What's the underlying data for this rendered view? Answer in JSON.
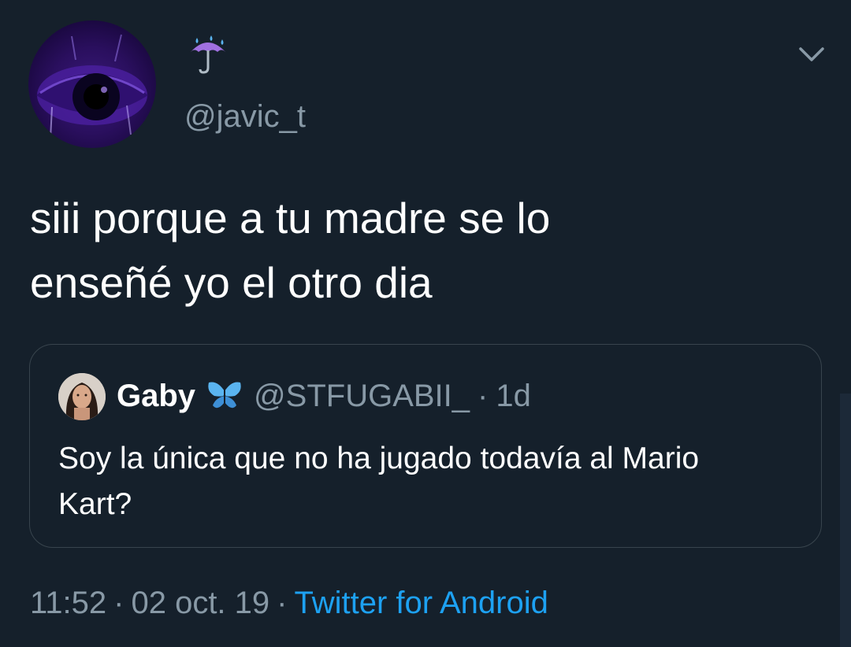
{
  "tweet": {
    "author": {
      "display_name_icon": "umbrella-with-rain-icon",
      "handle": "@javic_t"
    },
    "text_line_1": "siii porque a tu madre se lo",
    "text_line_2": "enseñé yo el otro dia",
    "quoted": {
      "display_name": "Gaby",
      "name_icon": "butterfly-icon",
      "handle": "@STFUGABII_",
      "separator": "·",
      "age": "1d",
      "text_line_1": "Soy la única que no ha jugado todavía al Mario",
      "text_line_2": "Kart?"
    },
    "meta": {
      "time": "11:52",
      "separator": "·",
      "date": "02 oct. 19",
      "source": "Twitter for Android"
    }
  },
  "colors": {
    "background": "#15202b",
    "text_primary": "#ffffff",
    "text_secondary": "#8899a6",
    "link": "#1da1f2",
    "border": "#38444d"
  }
}
